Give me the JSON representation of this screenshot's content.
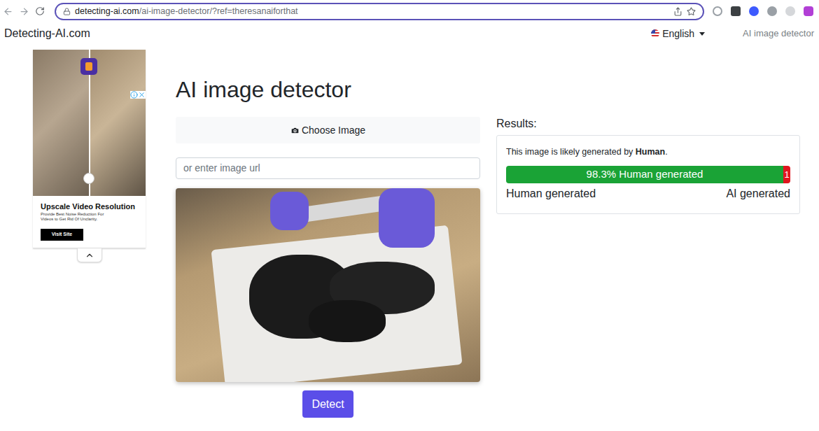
{
  "browser": {
    "url_domain": "detecting-ai.com",
    "url_path": "/ai-image-detector/?ref=theresanaiforthat"
  },
  "header": {
    "brand": "Detecting-AI.com",
    "language": "English",
    "nav_link": "AI image detector"
  },
  "ad": {
    "title": "Upscale Video Resolution",
    "text": "Provide Best Noise Reduction For Videos to Get Rid Of Unclarity.",
    "button": "Visit Site"
  },
  "detector": {
    "heading": "AI image detector",
    "choose_button": "Choose Image",
    "url_placeholder": "or enter image url",
    "detect_button": "Detect"
  },
  "results": {
    "label": "Results:",
    "verdict_prefix": "This image is likely generated by ",
    "verdict": "Human",
    "verdict_suffix": ".",
    "bar": {
      "level": 0.983,
      "human_text": "98.3% Human generated",
      "ai_text": "1"
    },
    "left_label": "Human generated",
    "right_label": "AI generated"
  }
}
